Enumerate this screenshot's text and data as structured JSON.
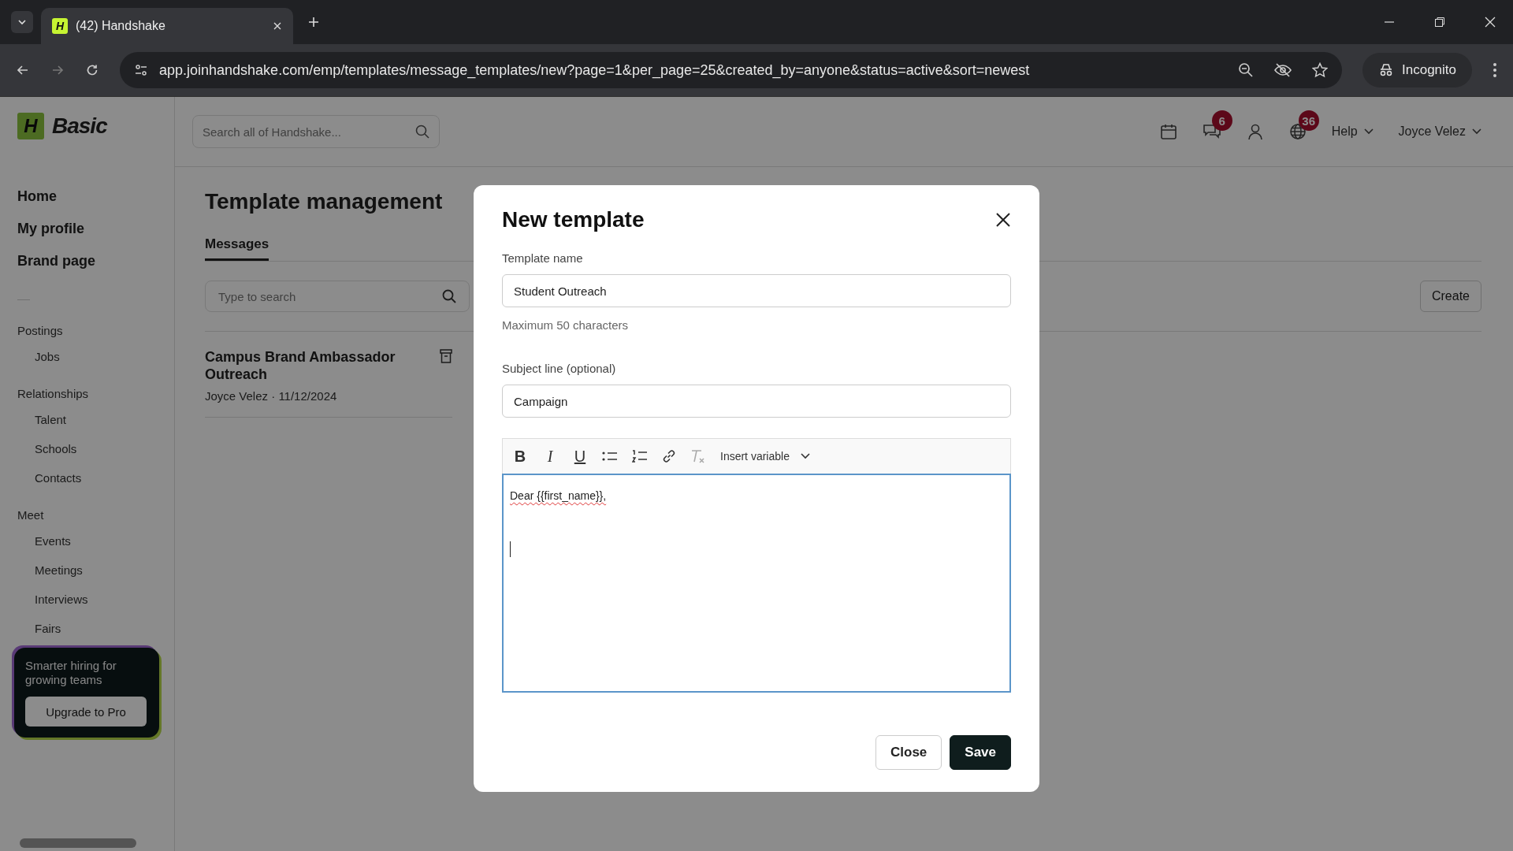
{
  "browser": {
    "tab_title": "(42) Handshake",
    "url": "app.joinhandshake.com/emp/templates/message_templates/new?page=1&per_page=25&created_by=anyone&status=active&sort=newest",
    "profile_label": "Incognito",
    "favicon_letter": "H"
  },
  "sidebar": {
    "logo_letter": "H",
    "logo_text": "Basic",
    "primary": [
      "Home",
      "My profile",
      "Brand page"
    ],
    "sections": [
      {
        "title": "Postings",
        "items": [
          "Jobs"
        ]
      },
      {
        "title": "Relationships",
        "items": [
          "Talent",
          "Schools",
          "Contacts"
        ]
      },
      {
        "title": "Meet",
        "items": [
          "Events",
          "Meetings",
          "Interviews",
          "Fairs"
        ]
      }
    ],
    "promo": {
      "text": "Smarter hiring for growing teams",
      "button": "Upgrade to Pro"
    }
  },
  "header": {
    "search_placeholder": "Search all of Handshake...",
    "message_badge": "6",
    "globe_badge": "36",
    "help": "Help",
    "user": "Joyce Velez"
  },
  "page": {
    "title": "Template management",
    "tabs": [
      {
        "label": "Messages",
        "selected": true
      }
    ],
    "search_placeholder": "Type to search",
    "create_button": "Create",
    "templates": [
      {
        "title": "Campus Brand Ambassador Outreach",
        "meta": "Joyce Velez · 11/12/2024"
      }
    ]
  },
  "modal": {
    "title": "New template",
    "name_label": "Template name",
    "name_value": "Student Outreach",
    "name_hint": "Maximum 50 characters",
    "subject_label": "Subject line (optional)",
    "subject_value": "Campaign",
    "toolbar": [
      {
        "kind": "bold",
        "glyph": "B",
        "disabled": false
      },
      {
        "kind": "italic",
        "glyph": "I",
        "disabled": false
      },
      {
        "kind": "underline",
        "glyph": "U",
        "disabled": false
      },
      {
        "kind": "bullets",
        "disabled": false
      },
      {
        "kind": "numbers",
        "disabled": false
      },
      {
        "kind": "link",
        "disabled": false
      },
      {
        "kind": "clear",
        "disabled": true
      }
    ],
    "insert_variable": "Insert variable",
    "body_text": "Dear {{first_name}},",
    "buttons": [
      {
        "label": "Close",
        "kind": "secondary"
      },
      {
        "label": "Save",
        "kind": "primary"
      }
    ]
  }
}
